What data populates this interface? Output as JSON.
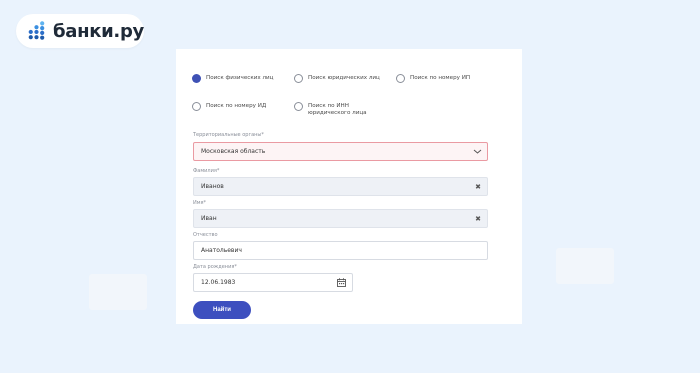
{
  "brand": {
    "name": "банки.ру"
  },
  "search_modes": [
    {
      "label": "Поиск физических лиц",
      "checked": true
    },
    {
      "label": "Поиск юридических лиц",
      "checked": false
    },
    {
      "label": "Поиск по номеру ИП",
      "checked": false
    },
    {
      "label": "Поиск по номеру ИД",
      "checked": false
    },
    {
      "label": "Поиск по ИНН юридического лица",
      "line1": "Поиск по ИНН",
      "line2": "юридического лица",
      "checked": false
    }
  ],
  "form": {
    "region": {
      "label": "Территориальные органы*",
      "value": "Московская область",
      "state": "error"
    },
    "lastname": {
      "label": "Фамилия*",
      "value": "Иванов"
    },
    "firstname": {
      "label": "Имя*",
      "value": "Иван"
    },
    "patronymic": {
      "label": "Отчество",
      "value": "Анатольевич"
    },
    "birthdate": {
      "label": "Дата рождения*",
      "value": "12.06.1983"
    },
    "submit_label": "Найти"
  },
  "colors": {
    "accent": "#3d4fbf",
    "error_border": "#ea9aa2",
    "page_bg": "#eaf3fd"
  },
  "icons": {
    "logo": "banki-dots-logo",
    "region_dropdown": "chevron-down-icon",
    "clear": "clear-icon",
    "date": "calendar-icon"
  }
}
